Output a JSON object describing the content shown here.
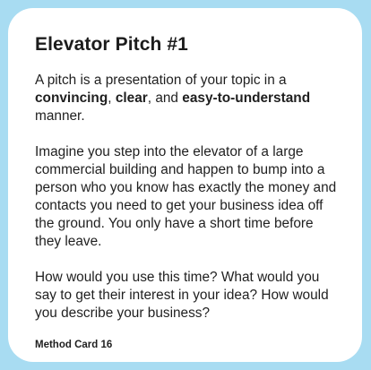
{
  "card": {
    "title": "Elevator Pitch #1",
    "intro": {
      "part1": "A pitch is a presentation of your topic in a ",
      "bold1": "convincing",
      "sep1": ", ",
      "bold2": "clear",
      "sep2": ", and ",
      "bold3": "easy-to-understand",
      "part2": " manner."
    },
    "scenario": "Imagine you step into the elevator of a large commercial building and happen to bump into a person who you know has exactly the money and contacts you need to get your business idea off the ground. You only have a short time before they leave.",
    "questions": "How would you use this time? What would you say to get their interest in your idea? How would you describe your business?",
    "footer": "Method Card 16"
  },
  "colors": {
    "background": "#a8dcf2",
    "card": "#ffffff",
    "text": "#1f1f1f"
  }
}
